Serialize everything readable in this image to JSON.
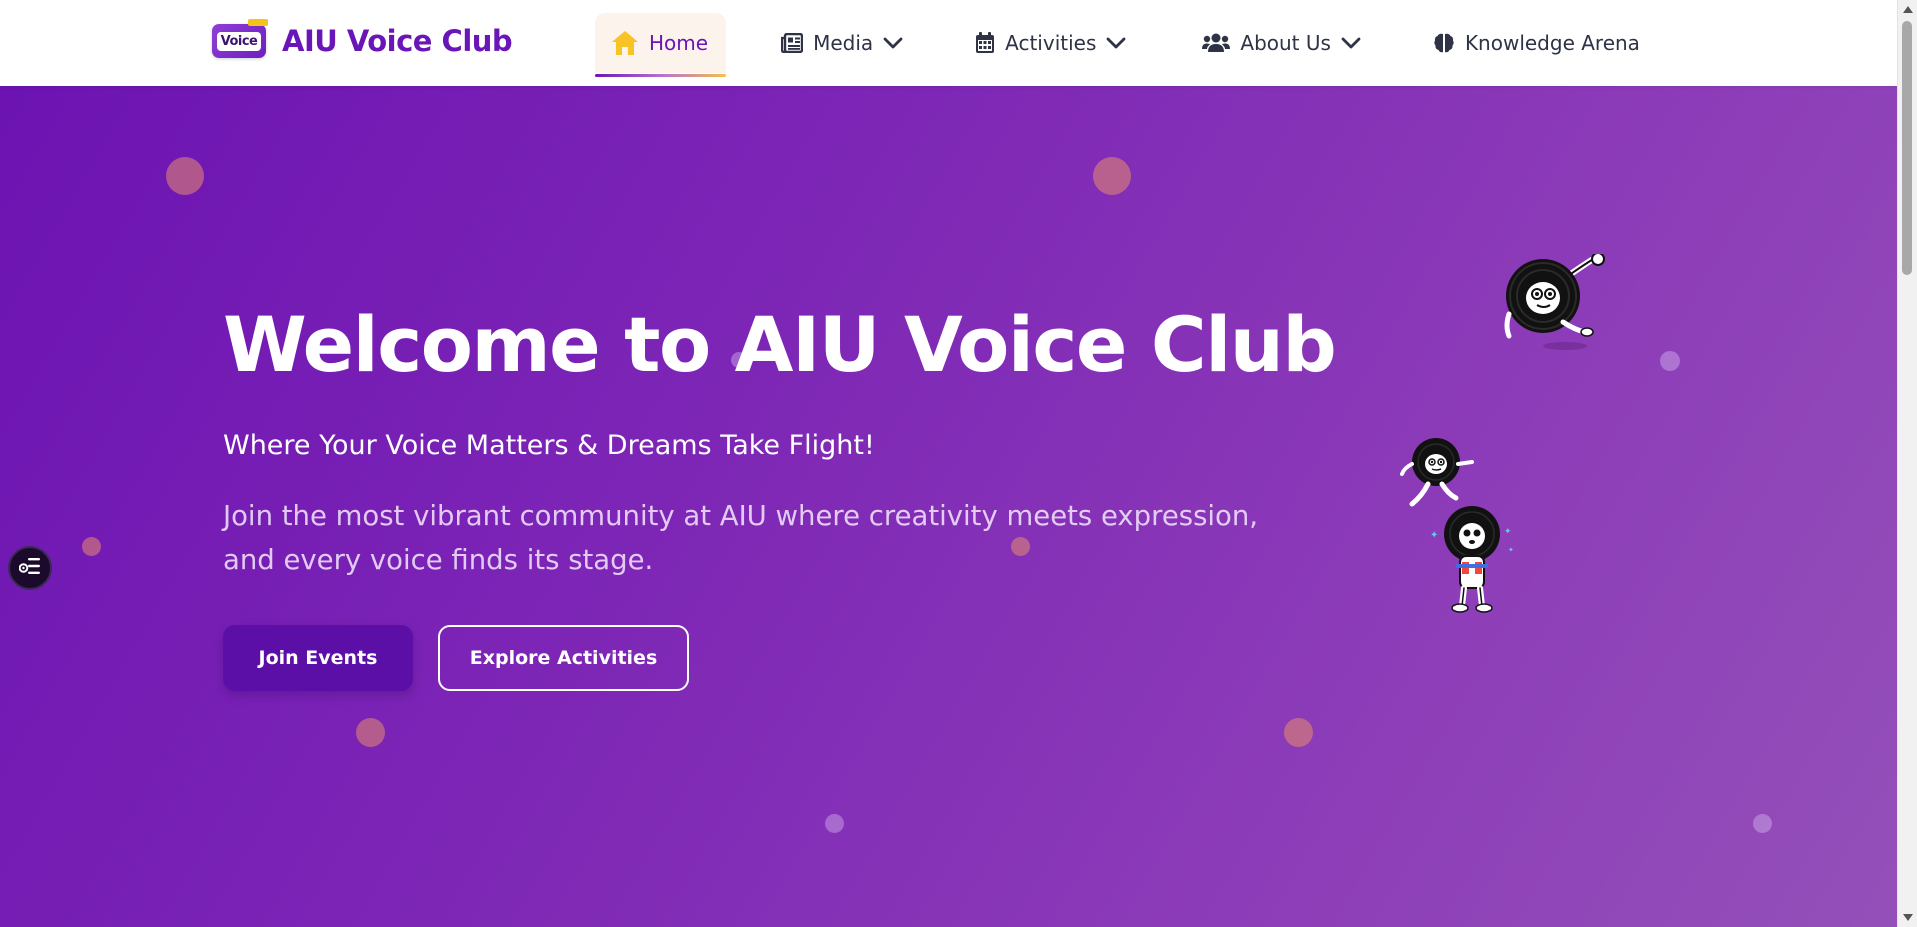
{
  "brand": {
    "logo_word": "Voice",
    "name": "AIU Voice Club"
  },
  "nav": {
    "items": [
      {
        "label": "Home",
        "icon": "home-icon",
        "active": true
      },
      {
        "label": "Media",
        "icon": "newspaper-icon",
        "dropdown": true
      },
      {
        "label": "Activities",
        "icon": "calendar-icon",
        "dropdown": true
      },
      {
        "label": "About Us",
        "icon": "users-icon",
        "dropdown": true
      },
      {
        "label": "Knowledge Arena",
        "icon": "brain-icon"
      }
    ]
  },
  "hero": {
    "title": "Welcome to AIU Voice Club",
    "subtitle": "Where Your Voice Matters & Dreams Take Flight!",
    "description": "Join the most vibrant community at AIU where creativity meets expression, and every voice finds its stage.",
    "primary_button": "Join Events",
    "secondary_button": "Explore Activities"
  },
  "colors": {
    "brand": "#6a15b8",
    "hero_start": "#6c13b2",
    "hero_end": "#9450b9",
    "home_icon": "#f7c325",
    "primary_button": "#5c0fa6"
  },
  "icons": {
    "side_widget": "settings-panel-icon",
    "mascot": "vinyl-record-mascot"
  }
}
